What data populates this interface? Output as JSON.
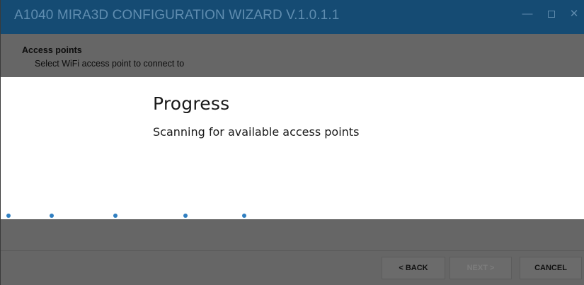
{
  "window": {
    "title": "A1040 MIRA3D CONFIGURATION WIZARD V.1.0.1.1",
    "controls": {
      "minimize": "—",
      "close": "✕"
    }
  },
  "header": {
    "title": "Access points",
    "subtitle": "Select WiFi access point to connect to"
  },
  "progress": {
    "title": "Progress",
    "message": "Scanning for available access points"
  },
  "buttons": {
    "back": "< BACK",
    "next": "NEXT >",
    "cancel": "CANCEL"
  },
  "colors": {
    "titlebar": "#154b73",
    "overlay": "#666666",
    "progress_dot": "#2f7fc1"
  }
}
